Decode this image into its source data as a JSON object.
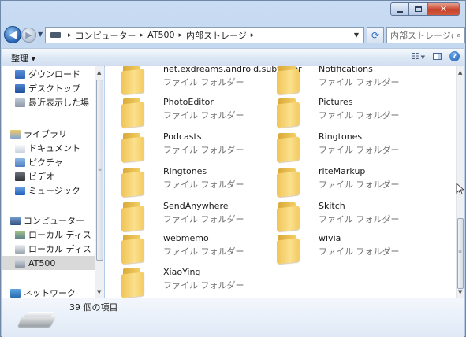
{
  "window": {
    "controls": {
      "minimize_icon": "minimize-icon",
      "maximize_icon": "maximize-icon",
      "close_glyph": "✕"
    }
  },
  "address_bar": {
    "breadcrumbs": [
      "コンピューター",
      "AT500",
      "内部ストレージ"
    ],
    "separator": "▸"
  },
  "search": {
    "placeholder": "内部ストレージの検索"
  },
  "toolbar": {
    "organize_label": "整理 ▾"
  },
  "nav_pane": {
    "items": [
      {
        "label": "ダウンロード",
        "icon": "downloads-folder-icon"
      },
      {
        "label": "デスクトップ",
        "icon": "desktop-icon"
      },
      {
        "label": "最近表示した場",
        "icon": "recent-places-icon"
      },
      {
        "label": "ライブラリ",
        "icon": "libraries-icon"
      },
      {
        "label": "ドキュメント",
        "icon": "documents-icon"
      },
      {
        "label": "ピクチャ",
        "icon": "pictures-icon"
      },
      {
        "label": "ビデオ",
        "icon": "videos-icon"
      },
      {
        "label": "ミュージック",
        "icon": "music-icon"
      },
      {
        "label": "コンピューター",
        "icon": "computer-icon"
      },
      {
        "label": "ローカル ディス",
        "icon": "local-disk-icon"
      },
      {
        "label": "ローカル ディス",
        "icon": "local-disk-icon"
      },
      {
        "label": "AT500",
        "icon": "portable-device-icon",
        "selected": true
      },
      {
        "label": "ネットワーク",
        "icon": "network-icon"
      }
    ]
  },
  "content": {
    "folder_type": "ファイル フォルダー",
    "folders": [
      {
        "name": "net.exdreams.android.subtalker"
      },
      {
        "name": "Notifications"
      },
      {
        "name": "PhotoEditor"
      },
      {
        "name": "Pictures"
      },
      {
        "name": "Podcasts"
      },
      {
        "name": "Ringtones"
      },
      {
        "name": "Ringtones"
      },
      {
        "name": "riteMarkup"
      },
      {
        "name": "SendAnywhere"
      },
      {
        "name": "Skitch"
      },
      {
        "name": "webmemo"
      },
      {
        "name": "wivia"
      },
      {
        "name": "XiaoYing"
      }
    ]
  },
  "details_pane": {
    "item_count": "39 個の項目",
    "icon": "portable-drive-icon"
  }
}
